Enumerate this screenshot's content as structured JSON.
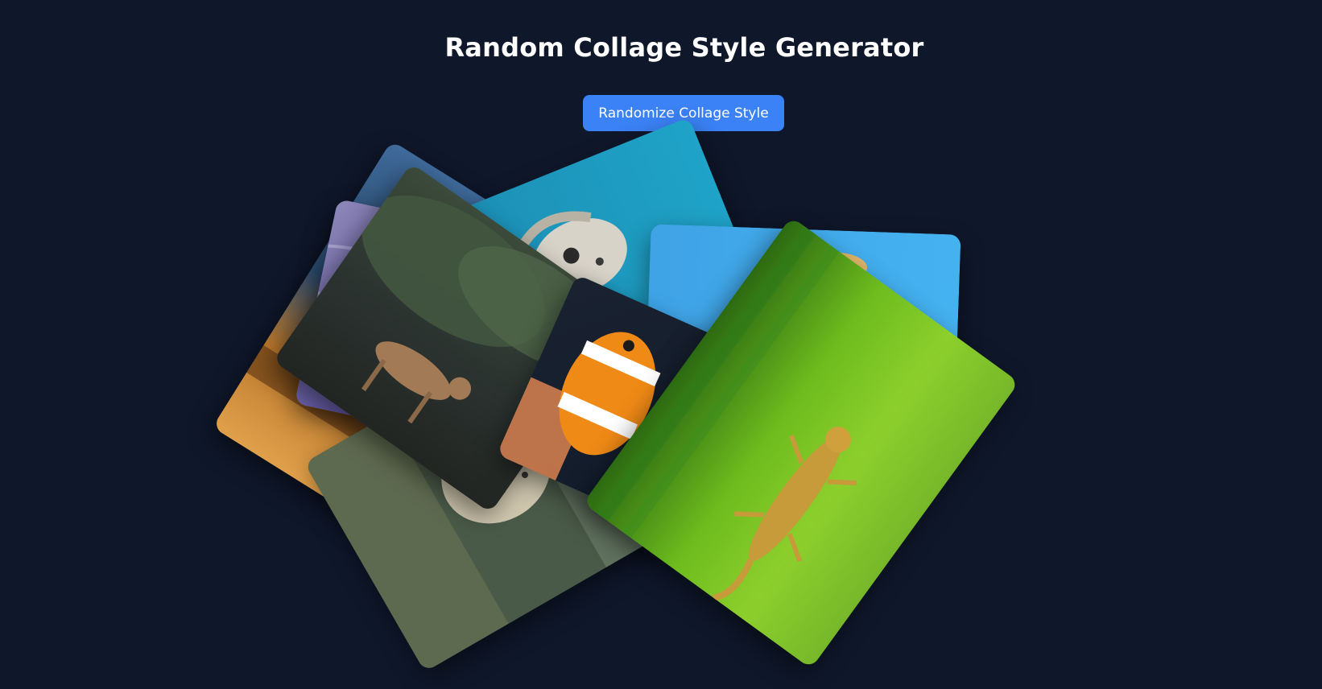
{
  "header": {
    "title": "Random Collage Style Generator"
  },
  "controls": {
    "randomize_label": "Randomize Collage Style",
    "accent_color": "#3b82f6"
  },
  "theme": {
    "background": "#0f172a"
  },
  "photos": [
    {
      "subject": "lake-sunset"
    },
    {
      "subject": "sea-turtle"
    },
    {
      "subject": "leopard"
    },
    {
      "subject": "deer"
    },
    {
      "subject": "bird-in-sky"
    },
    {
      "subject": "clownfish"
    },
    {
      "subject": "gecko-on-leaf"
    }
  ]
}
